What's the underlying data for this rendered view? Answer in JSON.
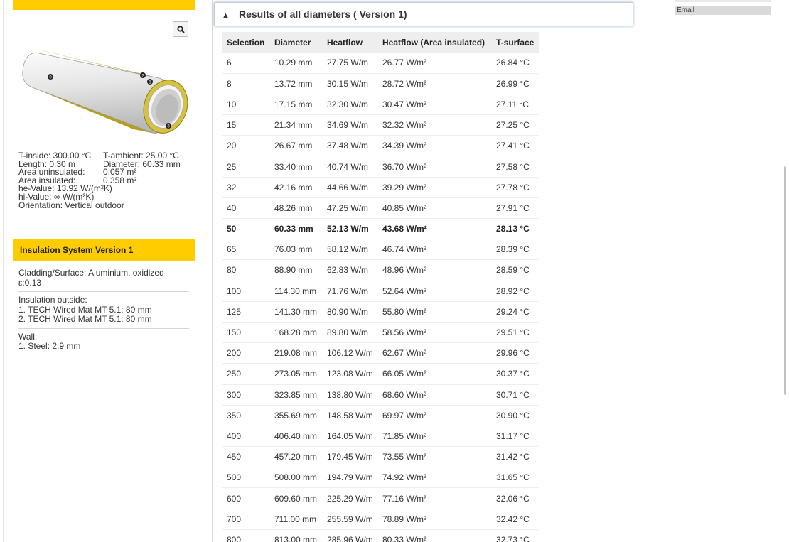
{
  "sidebar": {
    "params": {
      "t_inside": "T-inside: 300.00 °C",
      "t_ambient": "T-ambient: 25.00 °C",
      "length": "Length: 0.30 m",
      "diameter": "Diameter: 60.33 mm",
      "area_uninsulated_label": "Area uninsulated:",
      "area_uninsulated_value": "0.057 m²",
      "area_insulated_label": "Area insulated:",
      "area_insulated_value": "0.358 m²",
      "he_value": "he-Value: 13.92 W/(m²K)",
      "hi_value": "hi-Value: ∞ W/(m²K)",
      "orientation": "Orientation: Vertical outdoor"
    },
    "insulation": {
      "title": "Insulation System Version 1",
      "cladding": "Cladding/Surface: Aluminium, oxidized",
      "epsilon": "ε:0.13",
      "outside_title": "Insulation outside:",
      "layer1": "1. TECH Wired Mat MT 5.1: 80 mm",
      "layer2": "2. TECH Wired Mat MT 5.1: 80 mm",
      "wall_title": "Wall:",
      "wall1": "1. Steel: 2.9 mm"
    },
    "pipe_markers": [
      "0",
      "2",
      "1",
      "3"
    ],
    "search_icon": "search-icon"
  },
  "results": {
    "title": "Results of all diameters ( Version 1)",
    "columns": [
      "Selection",
      "Diameter",
      "Heatflow",
      "Heatflow (Area insulated)",
      "T-surface"
    ],
    "rows": [
      [
        "6",
        "10.29 mm",
        "27.75 W/m",
        "26.77 W/m²",
        "26.84 °C"
      ],
      [
        "8",
        "13.72 mm",
        "30.15 W/m",
        "28.72 W/m²",
        "26.99 °C"
      ],
      [
        "10",
        "17.15 mm",
        "32.30 W/m",
        "30.47 W/m²",
        "27.11 °C"
      ],
      [
        "15",
        "21.34 mm",
        "34.69 W/m",
        "32.32 W/m²",
        "27.25 °C"
      ],
      [
        "20",
        "26.67 mm",
        "37.48 W/m",
        "34.39 W/m²",
        "27.41 °C"
      ],
      [
        "25",
        "33.40 mm",
        "40.74 W/m",
        "36.70 W/m²",
        "27.58 °C"
      ],
      [
        "32",
        "42.16 mm",
        "44.66 W/m",
        "39.29 W/m²",
        "27.78 °C"
      ],
      [
        "40",
        "48.26 mm",
        "47.25 W/m",
        "40.85 W/m²",
        "27.91 °C"
      ],
      [
        "50",
        "60.33 mm",
        "52.13 W/m",
        "43.68 W/m²",
        "28.13 °C"
      ],
      [
        "65",
        "76.03 mm",
        "58.12 W/m",
        "46.74 W/m²",
        "28.39 °C"
      ],
      [
        "80",
        "88.90 mm",
        "62.83 W/m",
        "48.96 W/m²",
        "28.59 °C"
      ],
      [
        "100",
        "114.30 mm",
        "71.76 W/m",
        "52.64 W/m²",
        "28.92 °C"
      ],
      [
        "125",
        "141.30 mm",
        "80.90 W/m",
        "55.80 W/m²",
        "29.24 °C"
      ],
      [
        "150",
        "168.28 mm",
        "89.80 W/m",
        "58.56 W/m²",
        "29.51 °C"
      ],
      [
        "200",
        "219.08 mm",
        "106.12 W/m",
        "62.67 W/m²",
        "29.96 °C"
      ],
      [
        "250",
        "273.05 mm",
        "123.08 W/m",
        "66.05 W/m²",
        "30.37 °C"
      ],
      [
        "300",
        "323.85 mm",
        "138.80 W/m",
        "68.60 W/m²",
        "30.71 °C"
      ],
      [
        "350",
        "355.69 mm",
        "148.58 W/m",
        "69.97 W/m²",
        "30.90 °C"
      ],
      [
        "400",
        "406.40 mm",
        "164.05 W/m",
        "71.85 W/m²",
        "31.17 °C"
      ],
      [
        "450",
        "457.20 mm",
        "179.45 W/m",
        "73.55 W/m²",
        "31.42 °C"
      ],
      [
        "500",
        "508.00 mm",
        "194.79 W/m",
        "74.92 W/m²",
        "31.65 °C"
      ],
      [
        "600",
        "609.60 mm",
        "225.29 W/m",
        "77.16 W/m²",
        "32.06 °C"
      ],
      [
        "700",
        "711.00 mm",
        "255.59 W/m",
        "78.89 W/m²",
        "32.42 °C"
      ],
      [
        "800",
        "813.00 mm",
        "285.96 W/m",
        "80.33 W/m²",
        "32.73 °C"
      ]
    ],
    "highlighted_selection": "50"
  },
  "right": {
    "email_label": "Email"
  },
  "colors": {
    "accent": "#ffcc00",
    "header_bg": "#eeeeee"
  }
}
